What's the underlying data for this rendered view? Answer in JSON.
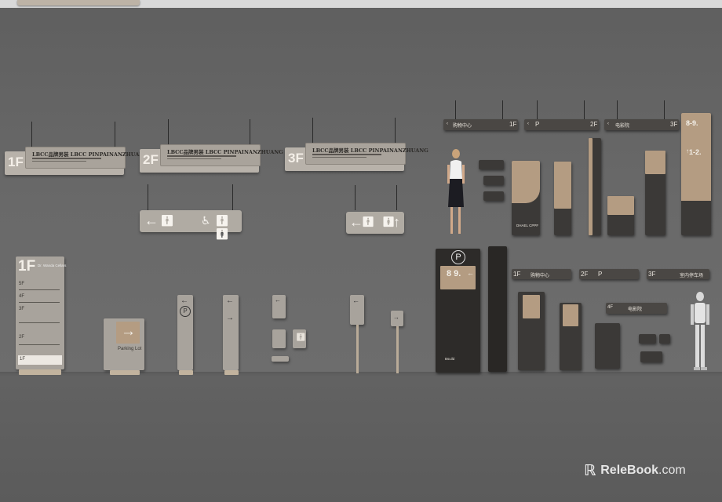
{
  "scene": {
    "colors": {
      "wall": "#666666",
      "floor": "#5b5b5b",
      "sign_grey": "#b8b2aa",
      "sign_dark": "#3b3937",
      "accent_tan": "#b49c82"
    }
  },
  "hanging_signs": [
    {
      "floor": "1F",
      "title": "LBCC品牌男装 LBCC PINPAINANZHUANG"
    },
    {
      "floor": "2F",
      "title": "LBCC品牌男装 LBCC PINPAINANZHUANG"
    },
    {
      "floor": "3F",
      "title": "LBCC品牌男装 LBCC PINPAINANZHUANG"
    }
  ],
  "toilet_boards": [
    {
      "glyphs": "← 🚹   ♿ 🚹🚺"
    },
    {
      "glyphs": "← 🚹   🚺 ↑"
    }
  ],
  "directory_totem": {
    "floor": "1F",
    "subtitle": "Dr. Wanda Cellars",
    "levels": [
      "5F",
      "4F",
      "3F",
      "2F",
      "1F"
    ]
  },
  "parking_sign": {
    "label": "Parking Lot",
    "arrow": "→"
  },
  "parking_pole": {
    "symbol": "P",
    "arrow": "←"
  },
  "small_pole": {
    "arrow_up": "←",
    "arrow_down": "→"
  },
  "dark_totem_right": {
    "numbers": "8-9.",
    "numbers2": "1-2.",
    "arrow": "←",
    "sub_arrow": "↑"
  },
  "ceiling_strips": [
    {
      "label": "购物中心",
      "floor": "1F",
      "arrow": "‹"
    },
    {
      "label": "P",
      "floor": "2F",
      "arrow": "‹"
    },
    {
      "label": "电影院",
      "floor": "3F",
      "arrow": "‹"
    }
  ],
  "lower_strips": [
    {
      "floor": "1F",
      "label": "购物中心"
    },
    {
      "floor": "2F",
      "label": "P"
    },
    {
      "floor": "3F",
      "label": "室内停车场"
    }
  ],
  "parking_totem": {
    "symbol": "P",
    "numbers": "8 9.",
    "arrow": "←",
    "brand": "Bsuild"
  },
  "small_plaque": {
    "floor": "4F",
    "label": "电影院"
  },
  "kiosk_label": "DHAEL CPPF",
  "watermark": {
    "brand": "ReleBook",
    "domain": ".com",
    "icon": "relebook-logo-icon"
  }
}
